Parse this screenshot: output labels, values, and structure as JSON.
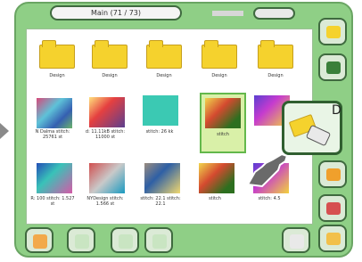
{
  "header": {
    "title": "Main (71 / 73)"
  },
  "folders": [
    {
      "label": "Design"
    },
    {
      "label": "Design"
    },
    {
      "label": "Design"
    },
    {
      "label": "Design"
    },
    {
      "label": "Design"
    }
  ],
  "thumbs": [
    {
      "label": "N Dalma\nstitch: 25761 st",
      "style": "t1"
    },
    {
      "label": "d: 11.11kB\nstitch: 11000 st",
      "style": "t2"
    },
    {
      "label": "stitch:\n26 kk",
      "style": "t3"
    },
    {
      "label": "stitch",
      "style": "t4"
    },
    {
      "label": "",
      "style": "t5"
    },
    {
      "label": "R: 100\nstitch: 1.527 st",
      "style": "t6"
    },
    {
      "label": "NYDesign\nstitch: 1.566 st",
      "style": "t7"
    },
    {
      "label": "stitch: 22.1\nstitch: 22.1",
      "style": "t8"
    },
    {
      "label": "stitch",
      "style": "t4"
    },
    {
      "label": "stitch: 4.5",
      "style": "t5"
    }
  ],
  "zoom": {
    "letter": "D"
  },
  "side_buttons": [
    "ok",
    "usb",
    "other",
    "transfer",
    "stitch"
  ],
  "bottom_buttons": [
    "home",
    "sewing",
    "prev",
    "next",
    "pointer",
    "tools"
  ]
}
